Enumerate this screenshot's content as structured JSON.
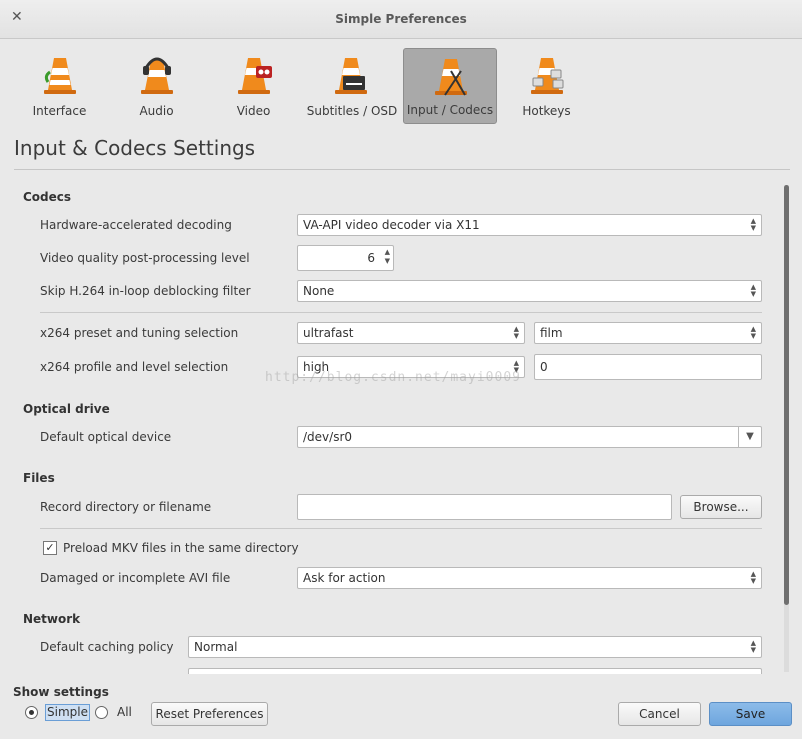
{
  "window": {
    "title": "Simple Preferences"
  },
  "toolbar": [
    {
      "label": "Interface"
    },
    {
      "label": "Audio"
    },
    {
      "label": "Video"
    },
    {
      "label": "Subtitles / OSD"
    },
    {
      "label": "Input / Codecs"
    },
    {
      "label": "Hotkeys"
    }
  ],
  "page_heading": "Input & Codecs Settings",
  "codecs": {
    "section": "Codecs",
    "hw_label": "Hardware-accelerated decoding",
    "hw_value": "VA-API video decoder via X11",
    "pp_label": "Video quality post-processing level",
    "pp_value": "6",
    "skip_label": "Skip H.264 in-loop deblocking filter",
    "skip_value": "None",
    "x264_preset_label": "x264 preset and tuning selection",
    "x264_preset_value": "ultrafast",
    "x264_tune_value": "film",
    "x264_profile_label": "x264 profile and level selection",
    "x264_profile_value": "high",
    "x264_level_value": "0"
  },
  "optical": {
    "section": "Optical drive",
    "device_label": "Default optical device",
    "device_value": "/dev/sr0"
  },
  "files": {
    "section": "Files",
    "record_label": "Record directory or filename",
    "record_value": "",
    "browse_label": "Browse...",
    "mkv_label": "Preload MKV files in the same directory",
    "mkv_checked": true,
    "avi_label": "Damaged or incomplete AVI file",
    "avi_value": "Ask for action"
  },
  "network": {
    "section": "Network",
    "caching_label": "Default caching policy",
    "caching_value": "Normal"
  },
  "watermark": "http://blog.csdn.net/mayi0009",
  "footer": {
    "show_settings_label": "Show settings",
    "simple_label": "Simple",
    "all_label": "All",
    "selected": "Simple",
    "reset_label": "Reset Preferences",
    "cancel_label": "Cancel",
    "save_label": "Save"
  }
}
